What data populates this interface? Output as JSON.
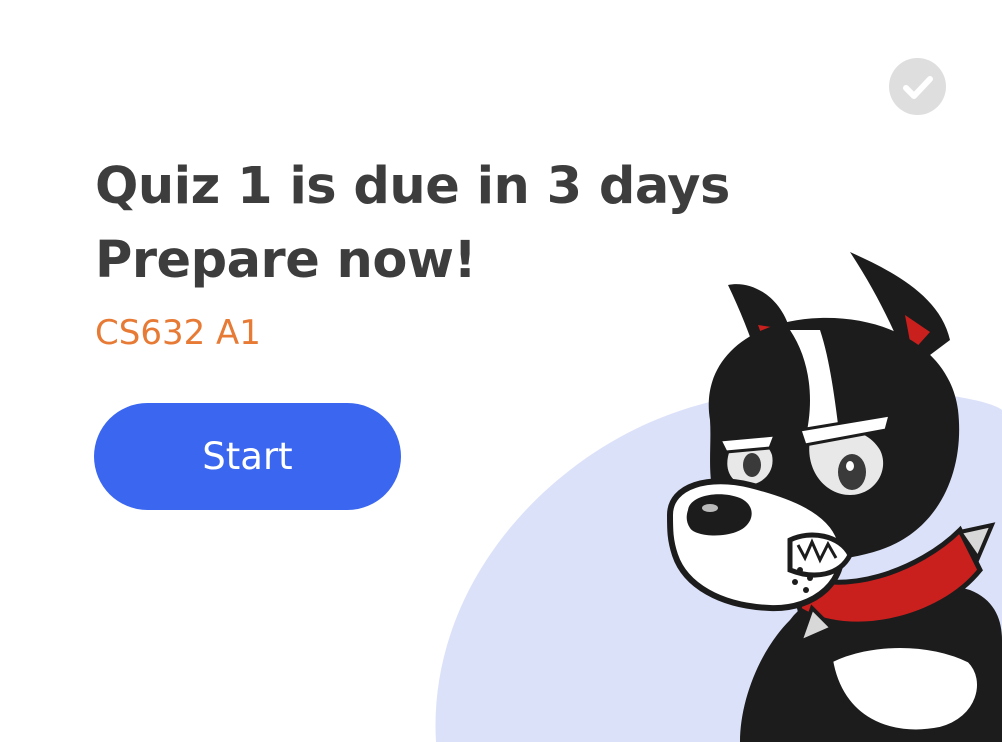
{
  "notification": {
    "title_line1": "Quiz 1 is due in 3 days",
    "title_line2": "Prepare now!",
    "course": "CS632 A1",
    "start_label": "Start",
    "dismiss_icon": "check-icon",
    "mascot": "bulldog-mascot"
  },
  "colors": {
    "title": "#3d3d3d",
    "course": "#e77a34",
    "button": "#3b67f0",
    "blob": "#dbe1f9",
    "check_circle": "#dedede"
  }
}
